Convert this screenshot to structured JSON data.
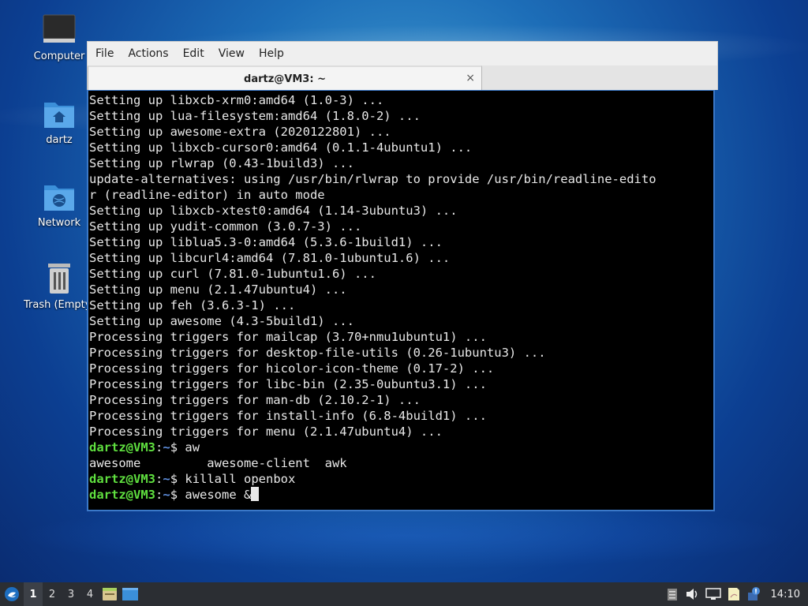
{
  "desktop": {
    "icons": [
      {
        "label": "Computer",
        "icon": "computer-icon"
      },
      {
        "label": "dartz",
        "icon": "home-folder-icon"
      },
      {
        "label": "Network",
        "icon": "network-folder-icon"
      },
      {
        "label": "Trash (Empty)",
        "icon": "trash-icon"
      }
    ]
  },
  "terminal": {
    "menu": [
      "File",
      "Actions",
      "Edit",
      "View",
      "Help"
    ],
    "tab_title": "dartz@VM3: ~",
    "tab_close": "×",
    "output": [
      "Setting up libxcb-xrm0:amd64 (1.0-3) ...",
      "Setting up lua-filesystem:amd64 (1.8.0-2) ...",
      "Setting up awesome-extra (2020122801) ...",
      "Setting up libxcb-cursor0:amd64 (0.1.1-4ubuntu1) ...",
      "Setting up rlwrap (0.43-1build3) ...",
      "update-alternatives: using /usr/bin/rlwrap to provide /usr/bin/readline-edito",
      "r (readline-editor) in auto mode",
      "Setting up libxcb-xtest0:amd64 (1.14-3ubuntu3) ...",
      "Setting up yudit-common (3.0.7-3) ...",
      "Setting up liblua5.3-0:amd64 (5.3.6-1build1) ...",
      "Setting up libcurl4:amd64 (7.81.0-1ubuntu1.6) ...",
      "Setting up curl (7.81.0-1ubuntu1.6) ...",
      "Setting up menu (2.1.47ubuntu4) ...",
      "Setting up feh (3.6.3-1) ...",
      "Setting up awesome (4.3-5build1) ...",
      "Processing triggers for mailcap (3.70+nmu1ubuntu1) ...",
      "Processing triggers for desktop-file-utils (0.26-1ubuntu3) ...",
      "Processing triggers for hicolor-icon-theme (0.17-2) ...",
      "Processing triggers for libc-bin (2.35-0ubuntu3.1) ...",
      "Processing triggers for man-db (2.10.2-1) ...",
      "Processing triggers for install-info (6.8-4build1) ...",
      "Processing triggers for menu (2.1.47ubuntu4) ..."
    ],
    "prompt_user": "dartz@VM3",
    "prompt_sep": ":",
    "prompt_path": "~",
    "prompt_dollar": "$ ",
    "cmd1": "aw",
    "completion": "awesome         awesome-client  awk",
    "cmd2": "killall openbox",
    "cmd3": "awesome &"
  },
  "taskbar": {
    "workspaces": [
      "1",
      "2",
      "3",
      "4"
    ],
    "active_workspace": "1",
    "clock": "14:10"
  }
}
